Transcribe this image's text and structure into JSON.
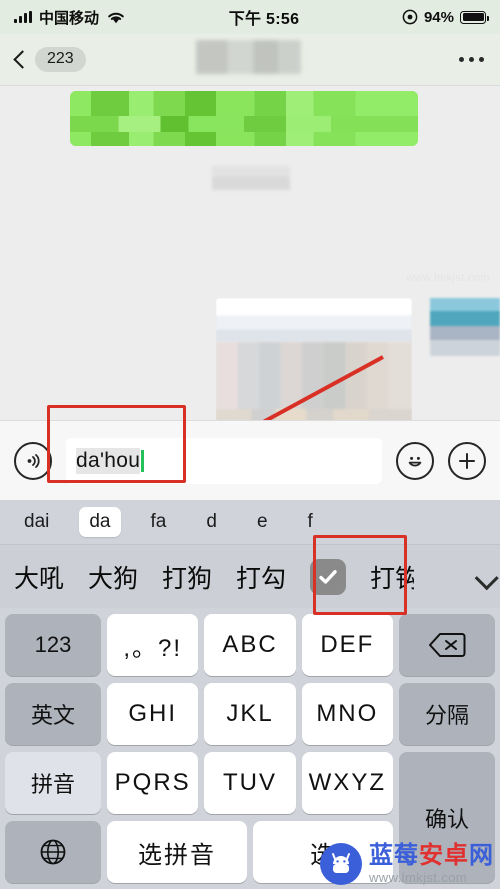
{
  "statusbar": {
    "carrier": "中国移动",
    "time": "下午 5:56",
    "battery_pct": "94%",
    "signal_icon": "signal-bars-icon",
    "wifi_icon": "wifi-icon",
    "alarm_icon": "alarm-clock-icon"
  },
  "navbar": {
    "back_icon": "chevron-left-icon",
    "unread_badge": "223",
    "title": "",
    "more_icon": "more-horizontal-icon"
  },
  "chat": {
    "watermark_faint": "www.lmkjst.com"
  },
  "inputbar": {
    "voice_icon": "voice-input-icon",
    "composing_text": "da'hou",
    "placeholder": "",
    "emoji_icon": "smiley-icon",
    "plus_icon": "plus-circle-icon"
  },
  "keyboard": {
    "pinyin_segments": [
      "dai",
      "da",
      "fa",
      "d",
      "e",
      "f"
    ],
    "pinyin_selected_index": 1,
    "candidates": [
      "大吼",
      "大狗",
      "打狗",
      "打勾"
    ],
    "candidate_emoji": "check-mark-button-emoji",
    "candidate_after_emoji": "打钩",
    "expand_icon": "chevron-down-icon",
    "rows": [
      [
        {
          "label": "123",
          "type": "fn"
        },
        {
          "label": ",。?!",
          "type": "main"
        },
        {
          "label": "ABC",
          "type": "main"
        },
        {
          "label": "DEF",
          "type": "main"
        },
        {
          "label": "backspace-icon",
          "type": "fn-icon"
        }
      ],
      [
        {
          "label": "英文",
          "type": "fn"
        },
        {
          "label": "GHI",
          "type": "main"
        },
        {
          "label": "JKL",
          "type": "main"
        },
        {
          "label": "MNO",
          "type": "main"
        },
        {
          "label": "分隔",
          "type": "fn"
        }
      ],
      [
        {
          "label": "拼音",
          "type": "fn-light"
        },
        {
          "label": "PQRS",
          "type": "main"
        },
        {
          "label": "TUV",
          "type": "main"
        },
        {
          "label": "WXYZ",
          "type": "main"
        }
      ],
      [
        {
          "label": "globe-icon",
          "type": "fn-icon"
        },
        {
          "label": "选拼音",
          "type": "main"
        },
        {
          "label": "选",
          "type": "main"
        }
      ]
    ],
    "confirm_key": "确认"
  },
  "watermark": {
    "name_blue": "蓝莓",
    "name_red": "安卓",
    "name_blue2": "网",
    "url": "www.lmkjst.com",
    "logo_icon": "android-mascot-icon"
  },
  "annotations": {
    "box_input": "highlight-box-input",
    "box_candidate": "highlight-box-check-candidate",
    "arrow": "red-arrow-pointing-to-input",
    "color": "#d93025"
  }
}
